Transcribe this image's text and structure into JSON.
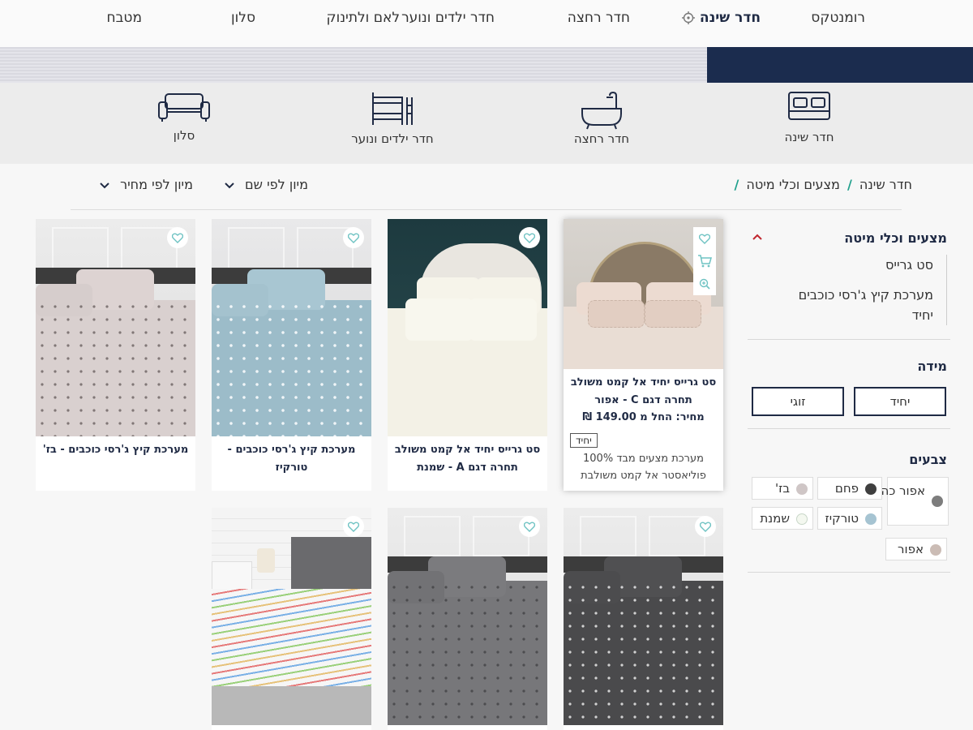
{
  "nav": {
    "items": [
      "רומנטקס",
      "חדר שינה",
      "חדר רחצה",
      "חדר ילדים ונוער",
      "לאם ולתינוק",
      "סלון",
      "מטבח"
    ],
    "active": "חדר שינה"
  },
  "categories": [
    "חדר שינה",
    "חדר רחצה",
    "חדר ילדים ונוער",
    "סלון"
  ],
  "breadcrumb": {
    "home": "חדר שינה",
    "current": "מצעים וכלי מיטה",
    "separator": "/"
  },
  "sort": {
    "by_name": "מיון לפי שם",
    "by_price": "מיון לפי מחיר"
  },
  "sidebar": {
    "category_title": "מצעים וכלי מיטה",
    "subcategories": [
      "סט גרייס",
      "מערכת קיץ ג'רסי כוכבים יחיד"
    ],
    "size_title": "מידה",
    "sizes": [
      "יחיד",
      "זוגי"
    ],
    "colors_title": "צבעים",
    "colors": [
      {
        "name": "אפור כהה",
        "hex": "#7d7d7d"
      },
      {
        "name": "פחם",
        "hex": "#3f3f3f"
      },
      {
        "name": "בז'",
        "hex": "#cfc6c6"
      },
      {
        "name": "טורקיז",
        "hex": "#a6c4d2"
      },
      {
        "name": "שמנת",
        "hex": "#f4f8f0"
      },
      {
        "name": "אפור",
        "hex": "#cbbcb5"
      }
    ]
  },
  "products": [
    {
      "title": "סט גרייס יחיד אל קמט משולב תחרה דגם C - אפור",
      "price": "מחיר: החל מ 149.00 ₪",
      "badge": "יחיד",
      "description": "מערכת מצעים מבד 100% פוליאסטר אל קמט משולבת",
      "featured": true,
      "icons": [
        "heart-icon",
        "cart-icon",
        "zoom-icon"
      ]
    },
    {
      "title": "סט גרייס יחיד אל קמט משולב תחרה דגם A - שמנת",
      "icons": [
        "heart-icon"
      ]
    },
    {
      "title": "מערכת קיץ ג'רסי כוכבים - טורקיז",
      "icons": [
        "heart-icon"
      ]
    },
    {
      "title": "מערכת קיץ ג'רסי כוכבים - בז'",
      "icons": [
        "heart-icon"
      ]
    },
    {
      "title": "",
      "icons": [
        "heart-icon"
      ]
    },
    {
      "title": "",
      "icons": [
        "heart-icon"
      ]
    },
    {
      "title": "",
      "icons": [
        "heart-icon"
      ]
    }
  ],
  "colors": {
    "navy": "#1f2a44",
    "accent_teal": "#1fa08c",
    "caret_red": "#c0262e",
    "heart": "#6fc3c3"
  }
}
